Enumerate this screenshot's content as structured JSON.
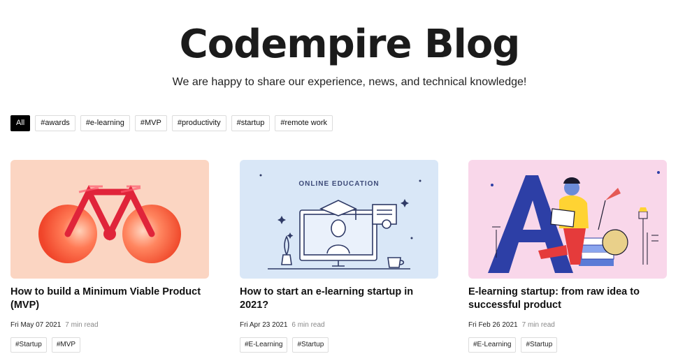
{
  "header": {
    "title": "Codempire Blog",
    "subtitle": "We are happy to share our experience, news, and technical knowledge!"
  },
  "filters": [
    {
      "label": "All",
      "active": true
    },
    {
      "label": "#awards"
    },
    {
      "label": "#e-learning"
    },
    {
      "label": "#MVP"
    },
    {
      "label": "#productivity"
    },
    {
      "label": "#startup"
    },
    {
      "label": "#remote work"
    }
  ],
  "posts": [
    {
      "title": "How to build a Minimum Viable Product (MVP)",
      "date": "Fri May 07 2021",
      "read_time": "7 min read",
      "tags": [
        "#Startup",
        "#MVP"
      ],
      "image": "bicycle-illustration",
      "bg_color": "#fbd5c2"
    },
    {
      "title": "How to start an e-learning startup in 2021?",
      "date": "Fri Apr 23 2021",
      "read_time": "6 min read",
      "tags": [
        "#E-Learning",
        "#Startup"
      ],
      "image": "online-education-illustration",
      "image_text": "ONLINE EDUCATION",
      "bg_color": "#d9e7f7"
    },
    {
      "title": "E-learning startup: from raw idea to successful product",
      "date": "Fri Feb 26 2021",
      "read_time": "7 min read",
      "tags": [
        "#E-Learning",
        "#Startup"
      ],
      "image": "reading-person-illustration",
      "bg_color": "#f9d7ea"
    }
  ]
}
